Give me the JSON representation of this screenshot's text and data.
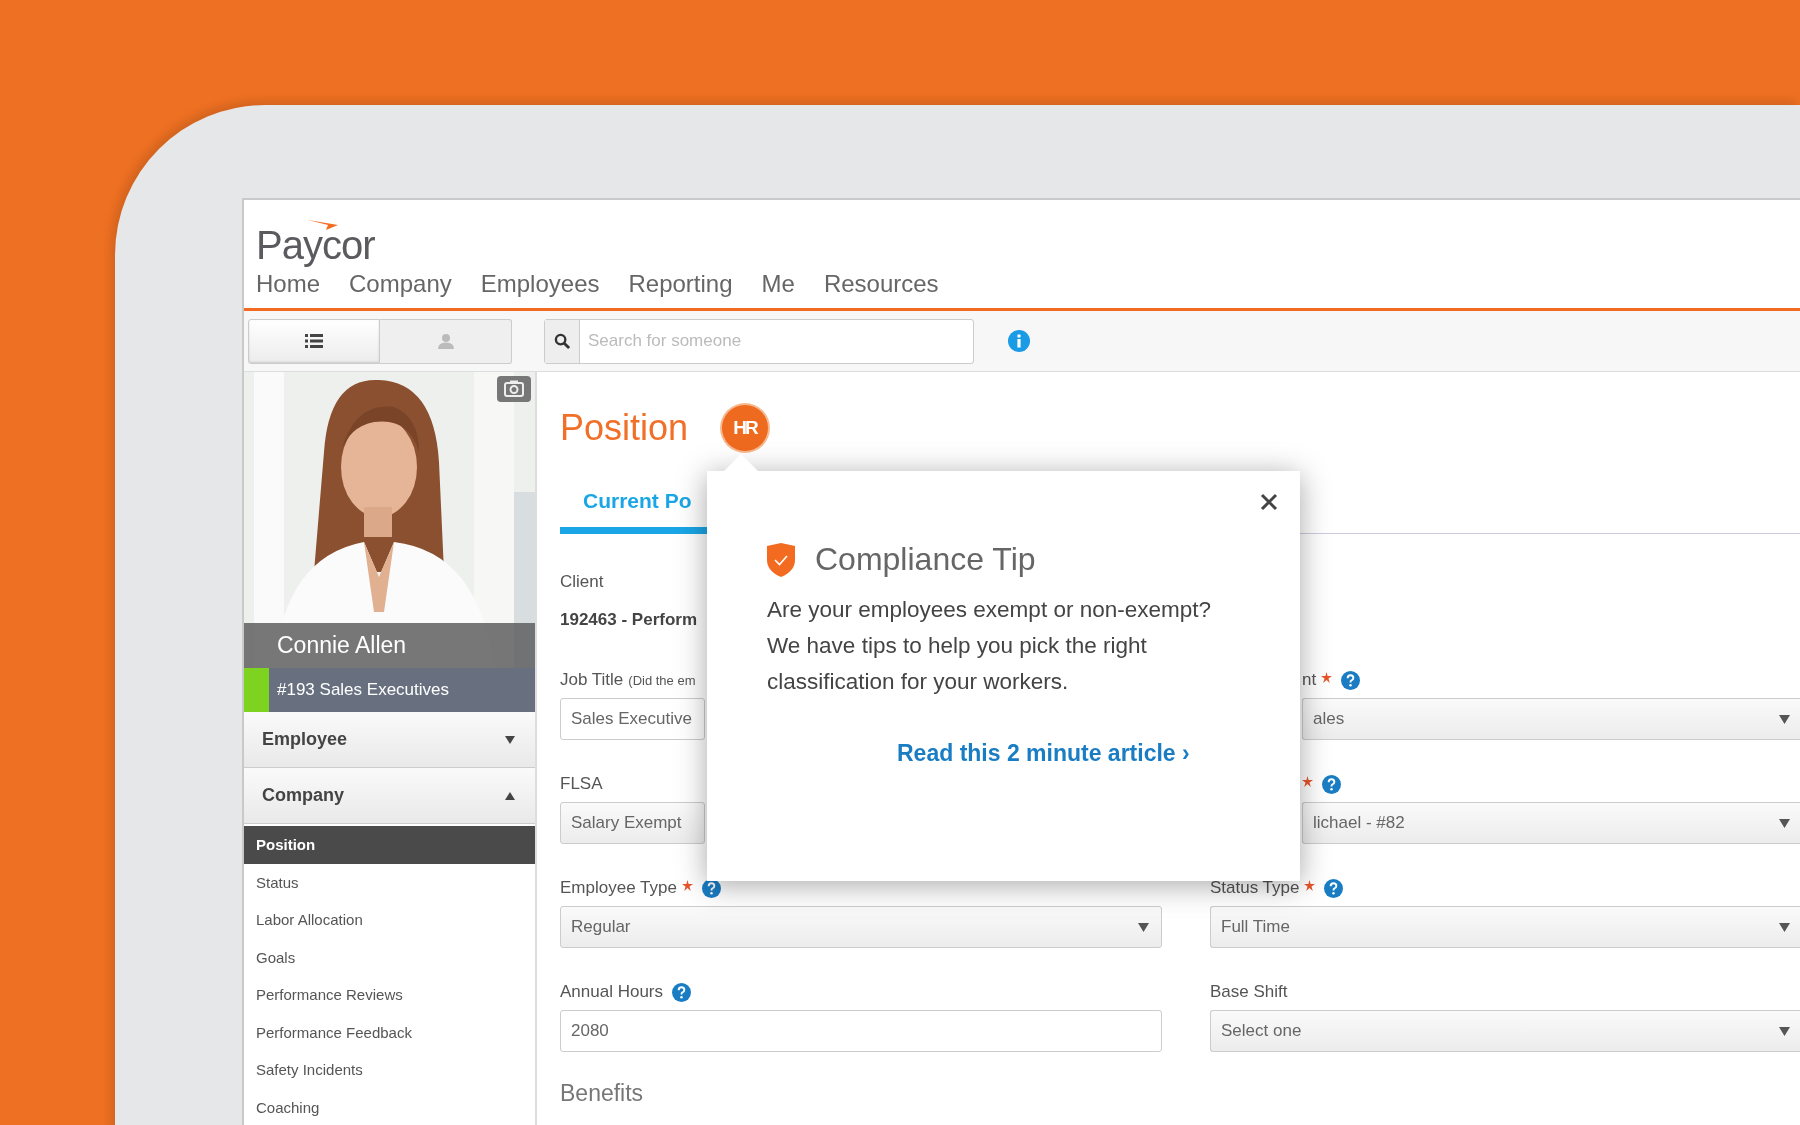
{
  "logo": {
    "text": "Paycor"
  },
  "nav": [
    "Home",
    "Company",
    "Employees",
    "Reporting",
    "Me",
    "Resources"
  ],
  "view_toggle": [
    {
      "kind": "list",
      "selected": true
    },
    {
      "kind": "person",
      "selected": false
    }
  ],
  "search": {
    "placeholder": "Search for someone"
  },
  "profile": {
    "name": "Connie Allen",
    "team": "#193 Sales Executives"
  },
  "sidebar": [
    {
      "label": "Employee",
      "expanded": false
    },
    {
      "label": "Company",
      "expanded": true,
      "items": [
        {
          "label": "Position",
          "selected": true
        },
        {
          "label": "Status",
          "selected": false
        },
        {
          "label": "Labor Allocation",
          "selected": false
        },
        {
          "label": "Goals",
          "selected": false
        },
        {
          "label": "Performance Reviews",
          "selected": false
        },
        {
          "label": "Performance Feedback",
          "selected": false
        },
        {
          "label": "Safety Incidents",
          "selected": false
        },
        {
          "label": "Coaching",
          "selected": false
        }
      ]
    }
  ],
  "page": {
    "title": "Position",
    "badge": "HR",
    "tabs": [
      {
        "label": "Current Po",
        "selected": true
      }
    ],
    "client": {
      "label": "Client",
      "value": "192463 - Perform"
    },
    "rows": [
      {
        "left": {
          "label": "Job Title",
          "note": "(Did the em",
          "required": false,
          "help": false,
          "kind": "text",
          "value": "Sales Executive",
          "covered": true
        },
        "right": {
          "label": "nt",
          "required": true,
          "help": true,
          "kind": "select",
          "value": "ales",
          "covered": true
        }
      },
      {
        "left": {
          "label": "FLSA",
          "required": false,
          "help": false,
          "kind": "readonly",
          "value": "Salary Exempt",
          "covered": true
        },
        "right": {
          "required": true,
          "help": true,
          "kind": "select",
          "value": "lichael - #82",
          "covered": true
        }
      },
      {
        "left": {
          "label": "Employee Type",
          "required": true,
          "help": true,
          "kind": "select",
          "value": "Regular",
          "covered": false
        },
        "right": {
          "label": "Status Type",
          "required": true,
          "help": true,
          "kind": "select",
          "value": "Full Time",
          "covered": false
        }
      },
      {
        "left": {
          "label": "Annual Hours",
          "required": false,
          "help": true,
          "kind": "text",
          "value": "2080",
          "covered": false
        },
        "right": {
          "label": "Base Shift",
          "required": false,
          "help": false,
          "kind": "select",
          "value": "Select one",
          "covered": false
        }
      }
    ],
    "section_heading": "Benefits"
  },
  "popup": {
    "title": "Compliance Tip",
    "body": "Are your employees exempt or non-exempt? We have tips to help you pick the right classification for your workers.",
    "link": "Read this 2 minute article ›"
  }
}
